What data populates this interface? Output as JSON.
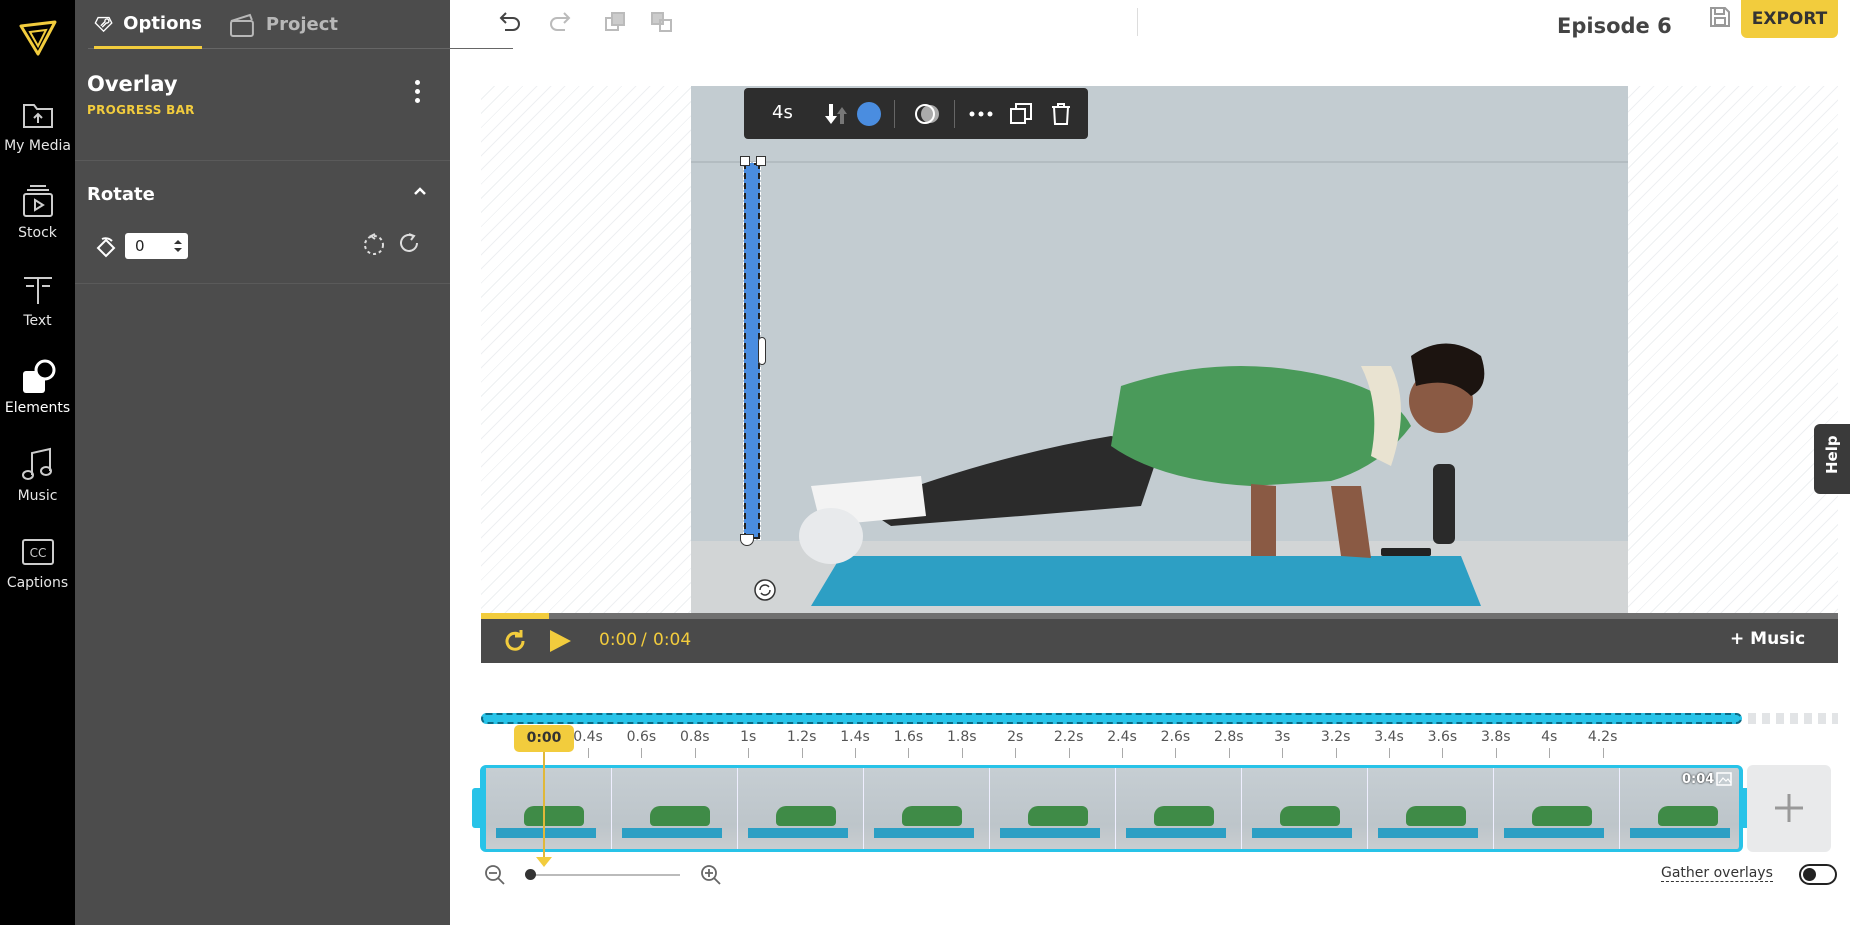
{
  "rail": {
    "items": [
      {
        "label": "My Media",
        "icon": "folder-upload-icon"
      },
      {
        "label": "Stock",
        "icon": "stock-video-icon"
      },
      {
        "label": "Text",
        "icon": "text-icon"
      },
      {
        "label": "Elements",
        "icon": "elements-icon",
        "active": true
      },
      {
        "label": "Music",
        "icon": "music-note-icon"
      },
      {
        "label": "Captions",
        "icon": "captions-cc-icon"
      }
    ]
  },
  "panel": {
    "tabs": [
      {
        "label": "Options"
      },
      {
        "label": "Project"
      }
    ],
    "overlay_title": "Overlay",
    "overlay_subtitle": "PROGRESS BAR",
    "rotate_title": "Rotate",
    "rotate_value": "0"
  },
  "topbar": {
    "project_name": "Episode 6",
    "export_label": "EXPORT"
  },
  "element_toolbar": {
    "duration": "4s"
  },
  "help": {
    "label": "Help"
  },
  "player": {
    "current_time": "0:00",
    "separator": "/",
    "total_time": "0:04",
    "progress": 0.05,
    "add_music_label": "+ Music"
  },
  "timeline": {
    "playhead_time": "0:00",
    "ticks": [
      "0.4s",
      "0.6s",
      "0.8s",
      "1s",
      "1.2s",
      "1.4s",
      "1.6s",
      "1.8s",
      "2s",
      "2.2s",
      "2.4s",
      "2.6s",
      "2.8s",
      "3s",
      "3.2s",
      "3.4s",
      "3.6s",
      "3.8s",
      "4s",
      "4.2s"
    ],
    "clip_duration": "0:04",
    "gather_label": "Gather overlays",
    "gather_enabled": false
  },
  "colors": {
    "accent": "#f2cc3d",
    "timeline_cyan": "#28c3e8",
    "overlay_bar": "#4a8de0",
    "panel_bg": "#4c4c4c",
    "rail_bg": "#000000"
  }
}
